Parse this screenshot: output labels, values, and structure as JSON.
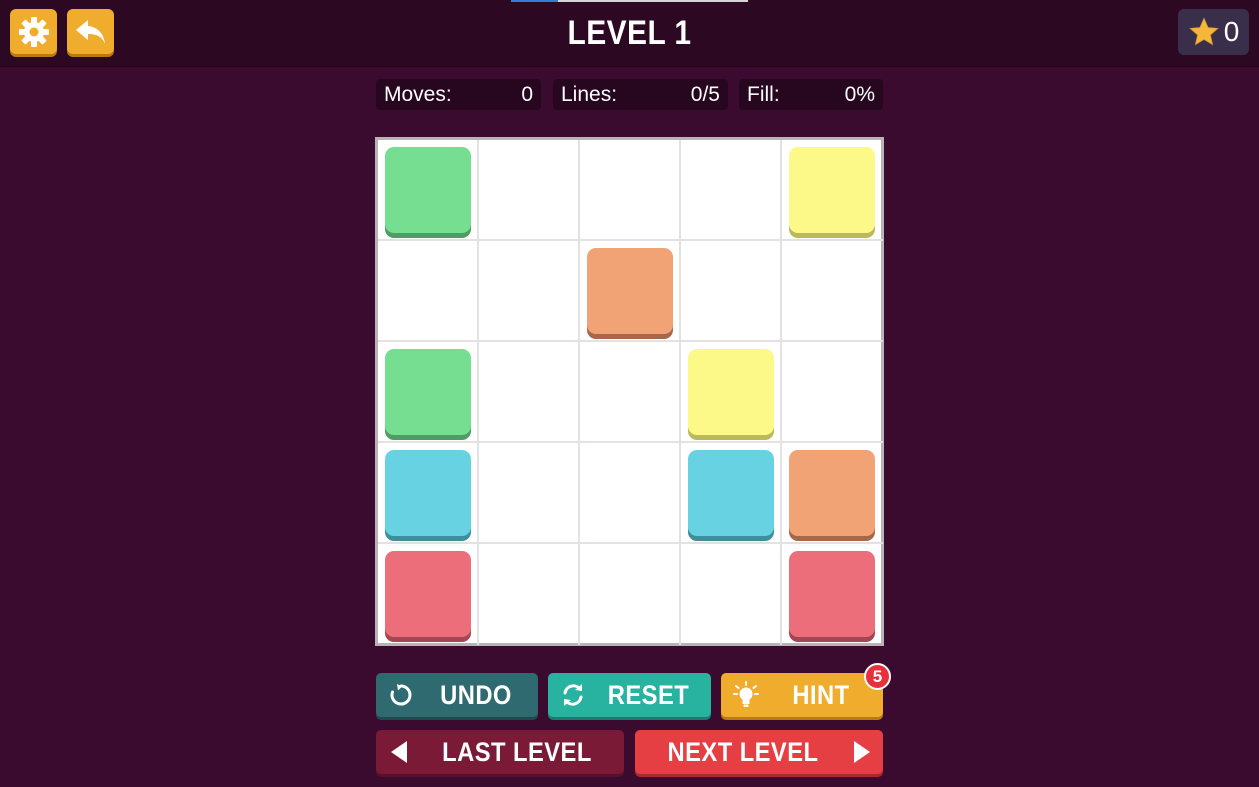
{
  "header": {
    "level_title": "LEVEL 1",
    "stars": "0",
    "level_progress": 0.2
  },
  "icons": {
    "settings": "gear-icon",
    "back": "back-arrow-icon",
    "star": "star-icon",
    "undo": "undo-icon",
    "reset": "reset-icon",
    "hint": "lightbulb-icon",
    "last_level": "triangle-left-icon",
    "next_level": "triangle-right-icon"
  },
  "stats": {
    "moves_label": "Moves:",
    "moves_value": "0",
    "lines_label": "Lines:",
    "lines_value": "0/5",
    "fill_label": "Fill:",
    "fill_value": "0%"
  },
  "board": {
    "rows": 5,
    "cols": 5,
    "colors": {
      "green": {
        "face": "#75de91",
        "shade": "#4f9c66"
      },
      "yellow": {
        "face": "#fdf989",
        "shade": "#bdb85a"
      },
      "orange": {
        "face": "#f2a375",
        "shade": "#a8664a"
      },
      "cyan": {
        "face": "#67d3e2",
        "shade": "#3f8e9b"
      },
      "red": {
        "face": "#ec6e7b",
        "shade": "#a54452"
      }
    },
    "dots": [
      {
        "row": 0,
        "col": 0,
        "color": "green"
      },
      {
        "row": 0,
        "col": 4,
        "color": "yellow"
      },
      {
        "row": 1,
        "col": 2,
        "color": "orange"
      },
      {
        "row": 2,
        "col": 0,
        "color": "green"
      },
      {
        "row": 2,
        "col": 3,
        "color": "yellow"
      },
      {
        "row": 3,
        "col": 0,
        "color": "cyan"
      },
      {
        "row": 3,
        "col": 3,
        "color": "cyan"
      },
      {
        "row": 3,
        "col": 4,
        "color": "orange"
      },
      {
        "row": 4,
        "col": 0,
        "color": "red"
      },
      {
        "row": 4,
        "col": 4,
        "color": "red"
      }
    ]
  },
  "buttons": {
    "undo": "UNDO",
    "reset": "RESET",
    "hint": "HINT",
    "hint_count": "5",
    "last_level": "LAST LEVEL",
    "next_level": "NEXT LEVEL"
  },
  "theme": {
    "background": "#3a0b2e",
    "undo_color": "#2e6a6f",
    "reset_color": "#27b3a0",
    "hint_color": "#f0ad2d",
    "last_level_color": "#7a1a36",
    "next_level_color": "#e53f44"
  }
}
